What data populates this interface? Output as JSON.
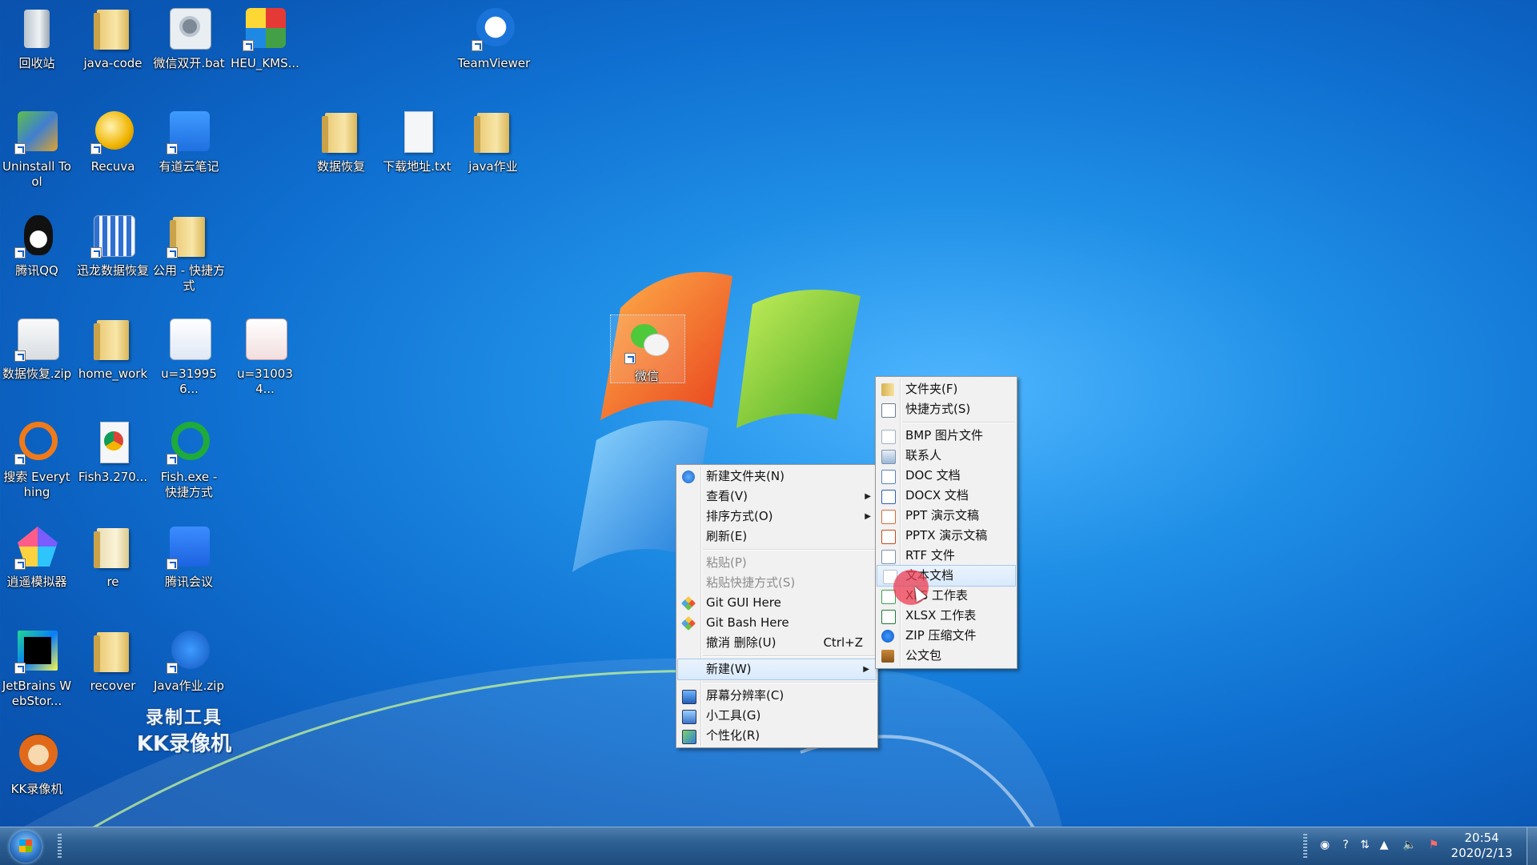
{
  "desktop": {
    "icons": [
      {
        "label": "回收站",
        "icon": "recycle-bin-icon"
      },
      {
        "label": "java-code",
        "icon": "folder-icon"
      },
      {
        "label": "微信双开.bat",
        "icon": "settings-file-icon"
      },
      {
        "label": "HEU_KMS...",
        "icon": "rubik-cube-icon"
      },
      {
        "label": "TeamViewer",
        "icon": "teamviewer-icon"
      },
      {
        "label": "Uninstall Tool",
        "icon": "uninstall-tool-icon"
      },
      {
        "label": "Recuva",
        "icon": "recuva-icon"
      },
      {
        "label": "有道云笔记",
        "icon": "youdao-note-icon"
      },
      {
        "label": "数据恢复",
        "icon": "folder-icon"
      },
      {
        "label": "下载地址.txt",
        "icon": "text-file-icon"
      },
      {
        "label": "java作业",
        "icon": "folder-icon"
      },
      {
        "label": "腾讯QQ",
        "icon": "qq-icon"
      },
      {
        "label": "迅龙数据恢复",
        "icon": "chart-app-icon"
      },
      {
        "label": "公用 - 快捷方式",
        "icon": "folder-icon"
      },
      {
        "label": "数据恢复.zip",
        "icon": "zip-icon"
      },
      {
        "label": "home_work",
        "icon": "folder-icon"
      },
      {
        "label": "u=319956...",
        "icon": "image-file-icon"
      },
      {
        "label": "u=310034...",
        "icon": "image-file-icon"
      },
      {
        "label": "搜索 Everything",
        "icon": "everything-search-icon"
      },
      {
        "label": "Fish3.270...",
        "icon": "chrome-icon"
      },
      {
        "label": "Fish.exe - 快捷方式",
        "icon": "fish-exe-icon"
      },
      {
        "label": "逍遥模拟器",
        "icon": "emulator-icon"
      },
      {
        "label": "re",
        "icon": "folder-icon"
      },
      {
        "label": "腾讯会议",
        "icon": "tencent-meeting-icon"
      },
      {
        "label": "JetBrains WebStor...",
        "icon": "webstorm-icon"
      },
      {
        "label": "recover",
        "icon": "folder-icon"
      },
      {
        "label": "Java作业.zip",
        "icon": "zip-icon"
      },
      {
        "label": "KK录像机",
        "icon": "kk-recorder-icon"
      },
      {
        "label": "微信",
        "icon": "wechat-icon"
      }
    ],
    "watermark": {
      "line1": "录制工具",
      "line2": "KK录像机"
    }
  },
  "context_menu": {
    "items": [
      {
        "label": "新建文件夹(N)",
        "icon": "new-folder-icon"
      },
      {
        "label": "查看(V)",
        "submenu": true
      },
      {
        "label": "排序方式(O)",
        "submenu": true
      },
      {
        "label": "刷新(E)"
      },
      {
        "label": "粘贴(P)",
        "disabled": true
      },
      {
        "label": "粘贴快捷方式(S)",
        "disabled": true
      },
      {
        "label": "Git GUI Here",
        "icon": "git-icon"
      },
      {
        "label": "Git Bash Here",
        "icon": "git-icon"
      },
      {
        "label": "撤消 删除(U)",
        "accel": "Ctrl+Z"
      },
      {
        "label": "新建(W)",
        "submenu": true,
        "highlighted": true
      },
      {
        "label": "屏幕分辨率(C)",
        "icon": "monitor-icon"
      },
      {
        "label": "小工具(G)",
        "icon": "gadgets-icon"
      },
      {
        "label": "个性化(R)",
        "icon": "personalize-icon"
      }
    ]
  },
  "new_submenu": {
    "items": [
      {
        "label": "文件夹(F)",
        "icon": "folder-icon"
      },
      {
        "label": "快捷方式(S)",
        "icon": "shortcut-icon"
      },
      {
        "label": "BMP 图片文件",
        "icon": "bmp-icon"
      },
      {
        "label": "联系人",
        "icon": "contact-icon"
      },
      {
        "label": "DOC 文档",
        "icon": "doc-icon"
      },
      {
        "label": "DOCX 文档",
        "icon": "docx-icon"
      },
      {
        "label": "PPT 演示文稿",
        "icon": "ppt-icon"
      },
      {
        "label": "PPTX 演示文稿",
        "icon": "pptx-icon"
      },
      {
        "label": "RTF 文件",
        "icon": "rtf-icon"
      },
      {
        "label": "文本文档",
        "icon": "text-document-icon",
        "highlighted": true
      },
      {
        "label": "XLS 工作表",
        "icon": "xls-icon"
      },
      {
        "label": "XLSX 工作表",
        "icon": "xlsx-icon"
      },
      {
        "label": "ZIP 压缩文件",
        "icon": "zip-icon"
      },
      {
        "label": "公文包",
        "icon": "briefcase-icon"
      }
    ]
  },
  "taskbar": {
    "clock_time": "20:54",
    "clock_date": "2020/2/13"
  }
}
